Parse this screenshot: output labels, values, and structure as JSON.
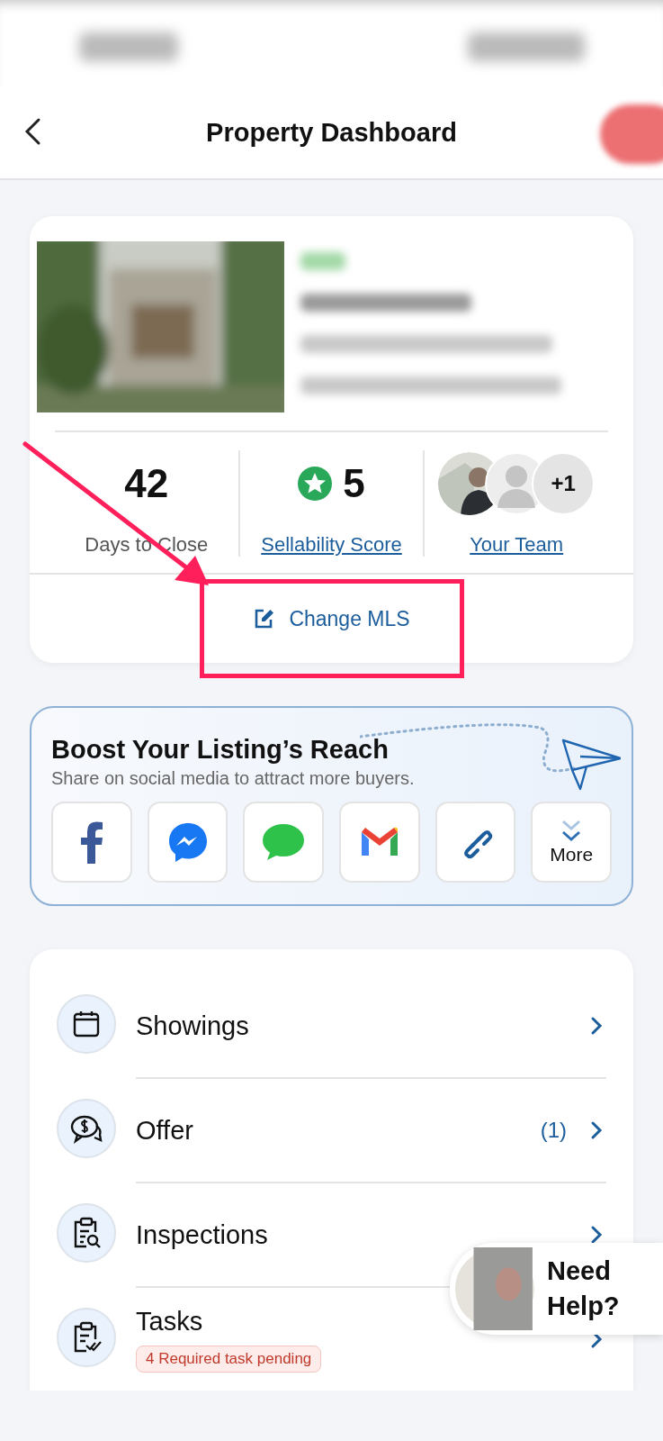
{
  "header": {
    "title": "Property Dashboard"
  },
  "stats": [
    {
      "kind": "number",
      "value": "42",
      "label": "Days to Close"
    },
    {
      "kind": "score",
      "value": "5",
      "label": "Sellability Score"
    },
    {
      "kind": "team",
      "extra": "+1",
      "label": "Your Team"
    }
  ],
  "change_mls": {
    "label": "Change MLS"
  },
  "share": {
    "title": "Boost Your Listing’s Reach",
    "subtitle": "Share on social media to attract more buyers.",
    "buttons": [
      {
        "kind": "facebook"
      },
      {
        "kind": "messenger"
      },
      {
        "kind": "messages"
      },
      {
        "kind": "gmail"
      },
      {
        "kind": "link"
      },
      {
        "kind": "more",
        "label": "More"
      }
    ]
  },
  "menu": [
    {
      "kind": "calendar",
      "label": "Showings"
    },
    {
      "kind": "offer",
      "label": "Offer",
      "count": "(1)"
    },
    {
      "kind": "inspection",
      "label": "Inspections"
    },
    {
      "kind": "tasks",
      "label": "Tasks",
      "badge": "4 Required task pending"
    }
  ],
  "help": {
    "label": "Need Help?"
  }
}
